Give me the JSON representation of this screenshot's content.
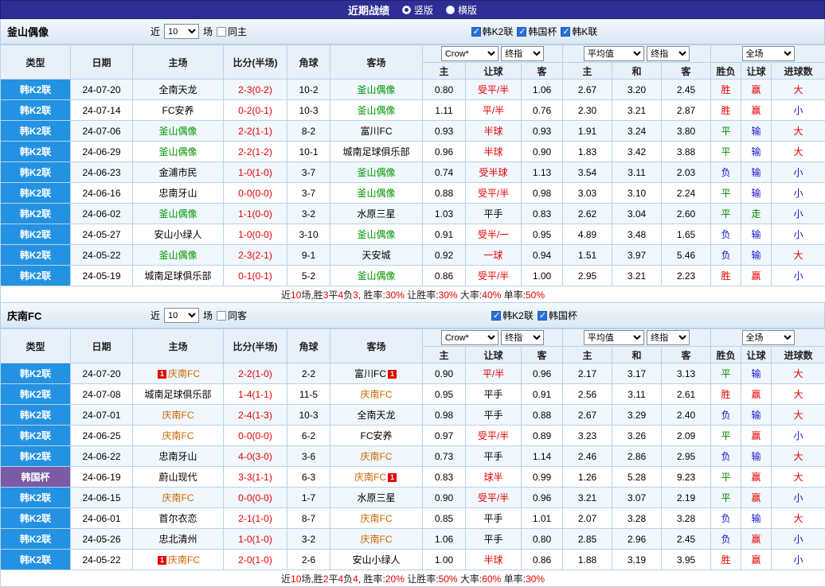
{
  "title_bar": {
    "title": "近期战绩",
    "options": [
      {
        "label": "竖版",
        "selected": true
      },
      {
        "label": "横版",
        "selected": false
      }
    ]
  },
  "palette": {
    "league_colors": {
      "韩K2联": "#2492e2",
      "韩国杯": "#7b5aa6"
    },
    "result_colors": {
      "胜": "#e60000",
      "平": "#008a00",
      "负": "#1414cc",
      "赢": "#e60000",
      "走": "#008a00",
      "输": "#1414cc",
      "大": "#e60000",
      "小": "#1414cc"
    },
    "handicap_color": "#e60000",
    "score_color": "#e60000",
    "red_card_color": "#e60000",
    "titlebar_bg": "#2e2e96"
  },
  "tables": [
    {
      "team": "釜山偶像",
      "team_color": "#009700",
      "filter": {
        "near_label": "近",
        "count": "10",
        "games_label": "场",
        "same_label": "同主",
        "same_checked": false,
        "leagues": [
          {
            "label": "韩K2联",
            "checked": true
          },
          {
            "label": "韩国杯",
            "checked": true
          },
          {
            "label": "韩K联",
            "checked": true
          }
        ]
      },
      "header": {
        "main": [
          "类型",
          "日期",
          "主场",
          "比分(半场)",
          "角球",
          "客场"
        ],
        "sel_company": "Crow*",
        "sel_stage1": "终指",
        "sel_avg": "平均值",
        "sel_stage2": "终指",
        "sel_scope": "全场",
        "sub": [
          "主",
          "让球",
          "客",
          "主",
          "和",
          "客",
          "胜负",
          "让球",
          "进球数"
        ]
      },
      "rows": [
        {
          "lg": "韩K2联",
          "date": "24-07-20",
          "home": "全南天龙",
          "score": "2-3(0-2)",
          "corner": "10-2",
          "away": "釜山偶像",
          "o1": "0.80",
          "hd": "受平/半",
          "o2": "1.06",
          "a1": "2.67",
          "a2": "3.20",
          "a3": "2.45",
          "r1": "胜",
          "r2": "赢",
          "r3": "大"
        },
        {
          "lg": "韩K2联",
          "date": "24-07-14",
          "home": "FC安养",
          "score": "0-2(0-1)",
          "corner": "10-3",
          "away": "釜山偶像",
          "o1": "1.11",
          "hd": "平/半",
          "o2": "0.76",
          "a1": "2.30",
          "a2": "3.21",
          "a3": "2.87",
          "r1": "胜",
          "r2": "赢",
          "r3": "小"
        },
        {
          "lg": "韩K2联",
          "date": "24-07-06",
          "home": "釜山偶像",
          "score": "2-2(1-1)",
          "corner": "8-2",
          "away": "富川FC",
          "o1": "0.93",
          "hd": "半球",
          "o2": "0.93",
          "a1": "1.91",
          "a2": "3.24",
          "a3": "3.80",
          "r1": "平",
          "r2": "输",
          "r3": "大"
        },
        {
          "lg": "韩K2联",
          "date": "24-06-29",
          "home": "釜山偶像",
          "score": "2-2(1-2)",
          "corner": "10-1",
          "away": "城南足球俱乐部",
          "o1": "0.96",
          "hd": "半球",
          "o2": "0.90",
          "a1": "1.83",
          "a2": "3.42",
          "a3": "3.88",
          "r1": "平",
          "r2": "输",
          "r3": "大"
        },
        {
          "lg": "韩K2联",
          "date": "24-06-23",
          "home": "金浦市民",
          "score": "1-0(1-0)",
          "corner": "3-7",
          "away": "釜山偶像",
          "o1": "0.74",
          "hd": "受半球",
          "o2": "1.13",
          "a1": "3.54",
          "a2": "3.11",
          "a3": "2.03",
          "r1": "负",
          "r2": "输",
          "r3": "小"
        },
        {
          "lg": "韩K2联",
          "date": "24-06-16",
          "home": "忠南牙山",
          "score": "0-0(0-0)",
          "corner": "3-7",
          "away": "釜山偶像",
          "o1": "0.88",
          "hd": "受平/半",
          "o2": "0.98",
          "a1": "3.03",
          "a2": "3.10",
          "a3": "2.24",
          "r1": "平",
          "r2": "输",
          "r3": "小"
        },
        {
          "lg": "韩K2联",
          "date": "24-06-02",
          "home": "釜山偶像",
          "score": "1-1(0-0)",
          "corner": "3-2",
          "away": "水原三星",
          "o1": "1.03",
          "hd": "平手",
          "o2": "0.83",
          "a1": "2.62",
          "a2": "3.04",
          "a3": "2.60",
          "r1": "平",
          "r2": "走",
          "r3": "小"
        },
        {
          "lg": "韩K2联",
          "date": "24-05-27",
          "home": "安山小绿人",
          "score": "1-0(0-0)",
          "corner": "3-10",
          "away": "釜山偶像",
          "o1": "0.91",
          "hd": "受半/一",
          "o2": "0.95",
          "a1": "4.89",
          "a2": "3.48",
          "a3": "1.65",
          "r1": "负",
          "r2": "输",
          "r3": "小"
        },
        {
          "lg": "韩K2联",
          "date": "24-05-22",
          "home": "釜山偶像",
          "score": "2-3(2-1)",
          "corner": "9-1",
          "away": "天安城",
          "o1": "0.92",
          "hd": "一球",
          "o2": "0.94",
          "a1": "1.51",
          "a2": "3.97",
          "a3": "5.46",
          "r1": "负",
          "r2": "输",
          "r3": "大"
        },
        {
          "lg": "韩K2联",
          "date": "24-05-19",
          "home": "城南足球俱乐部",
          "score": "0-1(0-1)",
          "corner": "5-2",
          "away": "釜山偶像",
          "o1": "0.86",
          "hd": "受平/半",
          "o2": "1.00",
          "a1": "2.95",
          "a2": "3.21",
          "a3": "2.23",
          "r1": "胜",
          "r2": "赢",
          "r3": "小"
        }
      ],
      "footer": [
        {
          "t": "近",
          "c": "k"
        },
        {
          "t": "10",
          "c": "r"
        },
        {
          "t": "场,胜",
          "c": "k"
        },
        {
          "t": "3",
          "c": "r"
        },
        {
          "t": "平",
          "c": "k"
        },
        {
          "t": "4",
          "c": "r"
        },
        {
          "t": "负",
          "c": "k"
        },
        {
          "t": "3",
          "c": "r"
        },
        {
          "t": ", 胜率:",
          "c": "k"
        },
        {
          "t": "30%",
          "c": "r"
        },
        {
          "t": " 让胜率:",
          "c": "k"
        },
        {
          "t": "30%",
          "c": "r"
        },
        {
          "t": " 大率:",
          "c": "k"
        },
        {
          "t": "40%",
          "c": "r"
        },
        {
          "t": " 单率:",
          "c": "k"
        },
        {
          "t": "50%",
          "c": "r"
        }
      ]
    },
    {
      "team": "庆南FC",
      "team_color": "#cc6600",
      "filter": {
        "near_label": "近",
        "count": "10",
        "games_label": "场",
        "same_label": "同客",
        "same_checked": false,
        "leagues": [
          {
            "label": "韩K2联",
            "checked": true
          },
          {
            "label": "韩国杯",
            "checked": true
          }
        ]
      },
      "header": {
        "main": [
          "类型",
          "日期",
          "主场",
          "比分(半场)",
          "角球",
          "客场"
        ],
        "sel_company": "Crow*",
        "sel_stage1": "终指",
        "sel_avg": "平均值",
        "sel_stage2": "终指",
        "sel_scope": "全场",
        "sub": [
          "主",
          "让球",
          "客",
          "主",
          "和",
          "客",
          "胜负",
          "让球",
          "进球数"
        ]
      },
      "rows": [
        {
          "lg": "韩K2联",
          "date": "24-07-20",
          "home": {
            "n": "庆南FC",
            "b": "1",
            "p": "before"
          },
          "score": "2-2(1-0)",
          "corner": "2-2",
          "away": {
            "n": "富川FC",
            "b": "1",
            "p": "after"
          },
          "o1": "0.90",
          "hd": "平/半",
          "o2": "0.96",
          "a1": "2.17",
          "a2": "3.17",
          "a3": "3.13",
          "r1": "平",
          "r2": "输",
          "r3": "大"
        },
        {
          "lg": "韩K2联",
          "date": "24-07-08",
          "home": "城南足球俱乐部",
          "score": "1-4(1-1)",
          "corner": "11-5",
          "away": "庆南FC",
          "o1": "0.95",
          "hd": "平手",
          "o2": "0.91",
          "a1": "2.56",
          "a2": "3.11",
          "a3": "2.61",
          "r1": "胜",
          "r2": "赢",
          "r3": "大"
        },
        {
          "lg": "韩K2联",
          "date": "24-07-01",
          "home": "庆南FC",
          "score": "2-4(1-3)",
          "corner": "10-3",
          "away": "全南天龙",
          "o1": "0.98",
          "hd": "平手",
          "o2": "0.88",
          "a1": "2.67",
          "a2": "3.29",
          "a3": "2.40",
          "r1": "负",
          "r2": "输",
          "r3": "大"
        },
        {
          "lg": "韩K2联",
          "date": "24-06-25",
          "home": "庆南FC",
          "score": "0-0(0-0)",
          "corner": "6-2",
          "away": "FC安养",
          "o1": "0.97",
          "hd": "受平/半",
          "o2": "0.89",
          "a1": "3.23",
          "a2": "3.26",
          "a3": "2.09",
          "r1": "平",
          "r2": "赢",
          "r3": "小"
        },
        {
          "lg": "韩K2联",
          "date": "24-06-22",
          "home": "忠南牙山",
          "score": "4-0(3-0)",
          "corner": "3-6",
          "away": "庆南FC",
          "o1": "0.73",
          "hd": "平手",
          "o2": "1.14",
          "a1": "2.46",
          "a2": "2.86",
          "a3": "2.95",
          "r1": "负",
          "r2": "输",
          "r3": "大"
        },
        {
          "lg": "韩国杯",
          "date": "24-06-19",
          "home": "蔚山现代",
          "score": "3-3(1-1)",
          "corner": "6-3",
          "away": {
            "n": "庆南FC",
            "b": "1",
            "p": "after"
          },
          "o1": "0.83",
          "hd": "球半",
          "o2": "0.99",
          "a1": "1.26",
          "a2": "5.28",
          "a3": "9.23",
          "r1": "平",
          "r2": "赢",
          "r3": "大"
        },
        {
          "lg": "韩K2联",
          "date": "24-06-15",
          "home": "庆南FC",
          "score": "0-0(0-0)",
          "corner": "1-7",
          "away": "水原三星",
          "o1": "0.90",
          "hd": "受平/半",
          "o2": "0.96",
          "a1": "3.21",
          "a2": "3.07",
          "a3": "2.19",
          "r1": "平",
          "r2": "赢",
          "r3": "小"
        },
        {
          "lg": "韩K2联",
          "date": "24-06-01",
          "home": "首尔衣恋",
          "score": "2-1(1-0)",
          "corner": "8-7",
          "away": "庆南FC",
          "o1": "0.85",
          "hd": "平手",
          "o2": "1.01",
          "a1": "2.07",
          "a2": "3.28",
          "a3": "3.28",
          "r1": "负",
          "r2": "输",
          "r3": "大"
        },
        {
          "lg": "韩K2联",
          "date": "24-05-26",
          "home": "忠北清州",
          "score": "1-0(1-0)",
          "corner": "3-2",
          "away": "庆南FC",
          "o1": "1.06",
          "hd": "平手",
          "o2": "0.80",
          "a1": "2.85",
          "a2": "2.96",
          "a3": "2.45",
          "r1": "负",
          "r2": "赢",
          "r3": "小"
        },
        {
          "lg": "韩K2联",
          "date": "24-05-22",
          "home": {
            "n": "庆南FC",
            "b": "1",
            "p": "before"
          },
          "score": "2-0(1-0)",
          "corner": "2-6",
          "away": "安山小绿人",
          "o1": "1.00",
          "hd": "半球",
          "o2": "0.86",
          "a1": "1.88",
          "a2": "3.19",
          "a3": "3.95",
          "r1": "胜",
          "r2": "赢",
          "r3": "小"
        }
      ],
      "footer": [
        {
          "t": "近",
          "c": "k"
        },
        {
          "t": "10",
          "c": "r"
        },
        {
          "t": "场,胜",
          "c": "k"
        },
        {
          "t": "2",
          "c": "r"
        },
        {
          "t": "平",
          "c": "k"
        },
        {
          "t": "4",
          "c": "r"
        },
        {
          "t": "负",
          "c": "k"
        },
        {
          "t": "4",
          "c": "r"
        },
        {
          "t": ", 胜率:",
          "c": "k"
        },
        {
          "t": "20%",
          "c": "r"
        },
        {
          "t": " 让胜率:",
          "c": "k"
        },
        {
          "t": "50%",
          "c": "r"
        },
        {
          "t": " 大率:",
          "c": "k"
        },
        {
          "t": "60%",
          "c": "r"
        },
        {
          "t": " 单率:",
          "c": "k"
        },
        {
          "t": "30%",
          "c": "r"
        }
      ]
    }
  ]
}
